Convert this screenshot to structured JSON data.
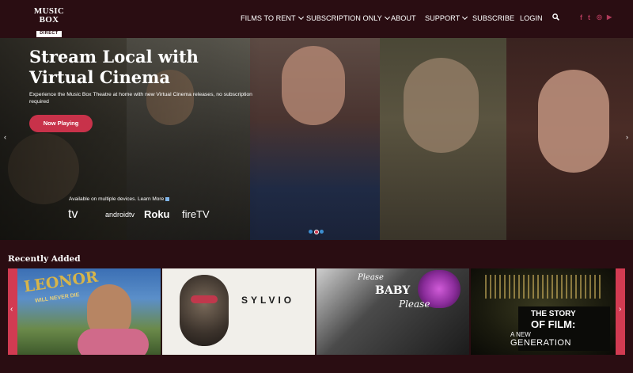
{
  "header": {
    "logo": {
      "line1": "MUSIC",
      "line2": "BOX",
      "line3": "DIRECT"
    },
    "nav": [
      {
        "label": "FILMS TO RENT",
        "dropdown": true
      },
      {
        "label": "SUBSCRIPTION ONLY",
        "dropdown": true
      },
      {
        "label": "ABOUT",
        "dropdown": false
      },
      {
        "label": "SUPPORT",
        "dropdown": true
      },
      {
        "label": "SUBSCRIBE",
        "dropdown": false
      },
      {
        "label": "LOGIN",
        "dropdown": false
      }
    ],
    "social": {
      "facebook": "f",
      "twitter": "t",
      "instagram": "◎",
      "youtube": "▶"
    }
  },
  "hero": {
    "title": "Stream Local with Virtual Cinema",
    "subtitle": "Experience the Music Box Theatre at home with new Virtual Cinema releases, no subscription required",
    "button_label": "Now Playing",
    "available_text": "Available on multiple devices. Learn More",
    "devices": {
      "appletv": "tv",
      "androidtv": "androidtv",
      "roku": "Roku",
      "firetv": "fireTV"
    },
    "slide_indicator": {
      "count": 3,
      "active_index": 1
    }
  },
  "recently_added": {
    "title": "Recently Added",
    "films": [
      {
        "title": "LEONOR",
        "subtitle": "WILL NEVER DIE"
      },
      {
        "title": "SYLVIO"
      },
      {
        "title_top": "Please",
        "title_mid": "BABY",
        "title_bottom": "Please"
      },
      {
        "title_line1": "THE STORY",
        "title_line2": "OF FILM:",
        "title_line3": "A NEW",
        "title_line4": "GENERATION"
      }
    ]
  },
  "colors": {
    "background": "#2a0d12",
    "accent": "#c8324a",
    "social": "#b03a5a"
  }
}
